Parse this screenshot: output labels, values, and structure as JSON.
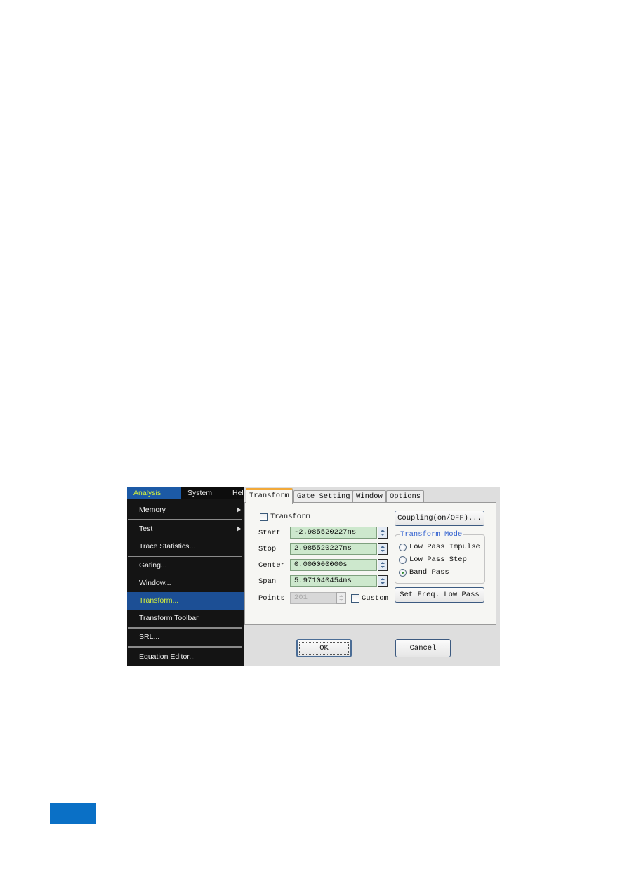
{
  "menu": {
    "bar": [
      "Analysis",
      "System",
      "Hel"
    ],
    "items": [
      {
        "label": "Memory",
        "submenu": true
      },
      {
        "label": "Test",
        "submenu": true
      },
      {
        "label": "Trace Statistics..."
      },
      {
        "label": "Gating..."
      },
      {
        "label": "Window..."
      },
      {
        "label": "Transform...",
        "selected": true
      },
      {
        "label": "Transform Toolbar"
      },
      {
        "label": "SRL..."
      },
      {
        "label": "Equation Editor..."
      }
    ]
  },
  "dialog": {
    "tabs": [
      "Transform",
      "Gate Setting",
      "Window",
      "Options"
    ],
    "active_tab": "Transform",
    "transform_checkbox": {
      "label": "Transform",
      "checked": false
    },
    "fields": [
      {
        "label": "Start",
        "value": "-2.985520227ns"
      },
      {
        "label": "Stop",
        "value": "2.985520227ns"
      },
      {
        "label": "Center",
        "value": "0.000000000s"
      },
      {
        "label": "Span",
        "value": "5.971040454ns"
      }
    ],
    "points": {
      "label": "Points",
      "value": "201",
      "disabled": true
    },
    "custom_checkbox": {
      "label": "Custom",
      "checked": false
    },
    "coupling_button": "Coupling(on/OFF)...",
    "transform_mode": {
      "title": "Transform Mode",
      "options": [
        "Low Pass Impulse",
        "Low Pass Step",
        "Band Pass"
      ],
      "selected": "Band Pass"
    },
    "set_freq_button": "Set Freq. Low Pass",
    "ok_button": "OK",
    "cancel_button": "Cancel"
  },
  "colors": {
    "menu_bg": "#141414",
    "menu_selected": "#1c4f95",
    "menu_selected_text": "#d6ef3c",
    "field_bg": "#cde8cd",
    "group_title": "#2f5fcf",
    "page_badge": "#0a70c6"
  }
}
